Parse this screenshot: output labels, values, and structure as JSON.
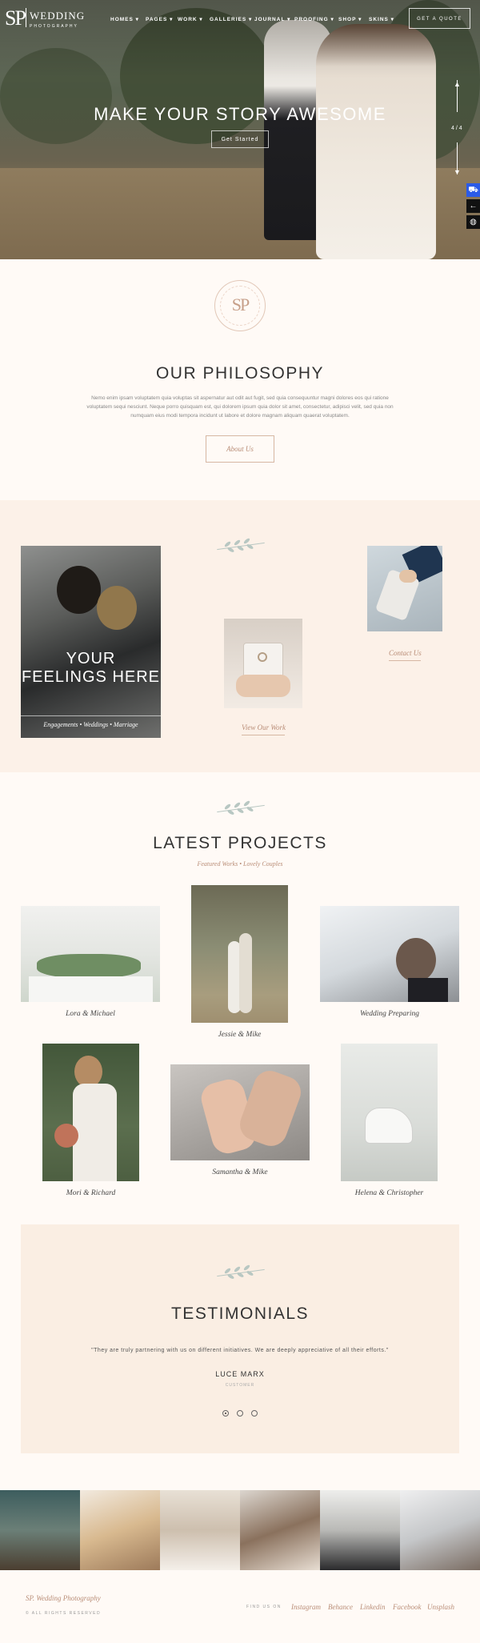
{
  "header": {
    "logo_mark": "SP",
    "logo_title": "WEDDING",
    "logo_subtitle": "PHOTOGRAPHY",
    "nav": [
      "HOMES ▾",
      "PAGES ▾",
      "WORK ▾",
      "GALLERIES ▾",
      "JOURNAL ▾",
      "PROOFING ▾",
      "SHOP ▾",
      "SKINS ▾"
    ],
    "quote_button": "GET A QUOTE"
  },
  "hero": {
    "title": "MAKE YOUR STORY AWESOME",
    "button": "Get Started",
    "slide_counter": "4 / 4",
    "side_buttons": [
      "cart-icon",
      "arrow-left-icon",
      "globe-icon"
    ]
  },
  "philosophy": {
    "badge_text": "SP",
    "title": "OUR PHILOSOPHY",
    "body": "Nemo enim ipsam voluptatem quia voluptas sit aspernatur aut odit aut fugit, sed quia consequuntur magni dolores eos qui ratione voluptatem sequi nesciunt. Neque porro quisquam est, qui dolorem ipsum quia dolor sit amet, consectetur, adipisci velit, sed quia non numquam eius modi tempora incidunt ut labore et dolore magnam aliquam quaerat voluptatem.",
    "button": "About Us"
  },
  "feelings": {
    "overlay_title": "YOUR FEELINGS HERE",
    "overlay_tags": "Engagements • Weddings • Marriage",
    "view_work": "View Our Work",
    "contact": "Contact Us"
  },
  "projects": {
    "title": "LATEST PROJECTS",
    "subtitle": "Featured Works • Lovely Couples",
    "items": [
      {
        "caption": "Lora & Michael"
      },
      {
        "caption": "Jessie & Mike"
      },
      {
        "caption": "Wedding Preparing"
      },
      {
        "caption": "Mori & Richard"
      },
      {
        "caption": "Samantha & Mike"
      },
      {
        "caption": "Helena & Christopher"
      }
    ]
  },
  "testimonials": {
    "title": "TESTIMONIALS",
    "quote": "\"They are truly partnering with us on different initiatives. We are deeply appreciative of all their efforts.\"",
    "author": "LUCE MARX",
    "role": "CUSTOMER"
  },
  "footer": {
    "brand": "SP. Wedding Photography",
    "copyright": "© ALL RIGHTS RESERVED",
    "find_us": "FIND US ON",
    "links": [
      "Instagram",
      "Behance",
      "Linkedin",
      "Facebook",
      "Unsplash"
    ]
  },
  "colors": {
    "accent": "#b98d77",
    "cream": "#fffaf6",
    "testimonial_bg": "#faeee3",
    "blue_button": "#2b5be8"
  }
}
